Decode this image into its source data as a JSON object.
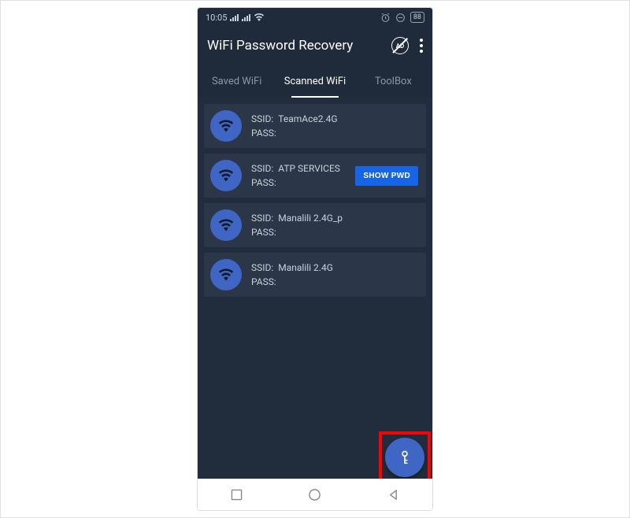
{
  "statusBar": {
    "time": "10:05",
    "battery": "88"
  },
  "appBar": {
    "title": "WiFi Password Recovery",
    "adLabel": "AD"
  },
  "tabs": [
    {
      "label": "Saved WiFi",
      "active": false
    },
    {
      "label": "Scanned WiFi",
      "active": true
    },
    {
      "label": "ToolBox",
      "active": false
    }
  ],
  "rows": [
    {
      "ssidLabel": "SSID:",
      "ssid": "TeamAce2.4G",
      "passLabel": "PASS:",
      "pass": "",
      "showPwd": false
    },
    {
      "ssidLabel": "SSID:",
      "ssid": "ATP SERVICES",
      "passLabel": "PASS:",
      "pass": "",
      "showPwd": true
    },
    {
      "ssidLabel": "SSID:",
      "ssid": "Manalili 2.4G_p",
      "passLabel": "PASS:",
      "pass": "",
      "showPwd": false
    },
    {
      "ssidLabel": "SSID:",
      "ssid": "Manalili 2.4G",
      "passLabel": "PASS:",
      "pass": "",
      "showPwd": false
    }
  ],
  "buttons": {
    "showPwd": "SHOW PWD"
  }
}
